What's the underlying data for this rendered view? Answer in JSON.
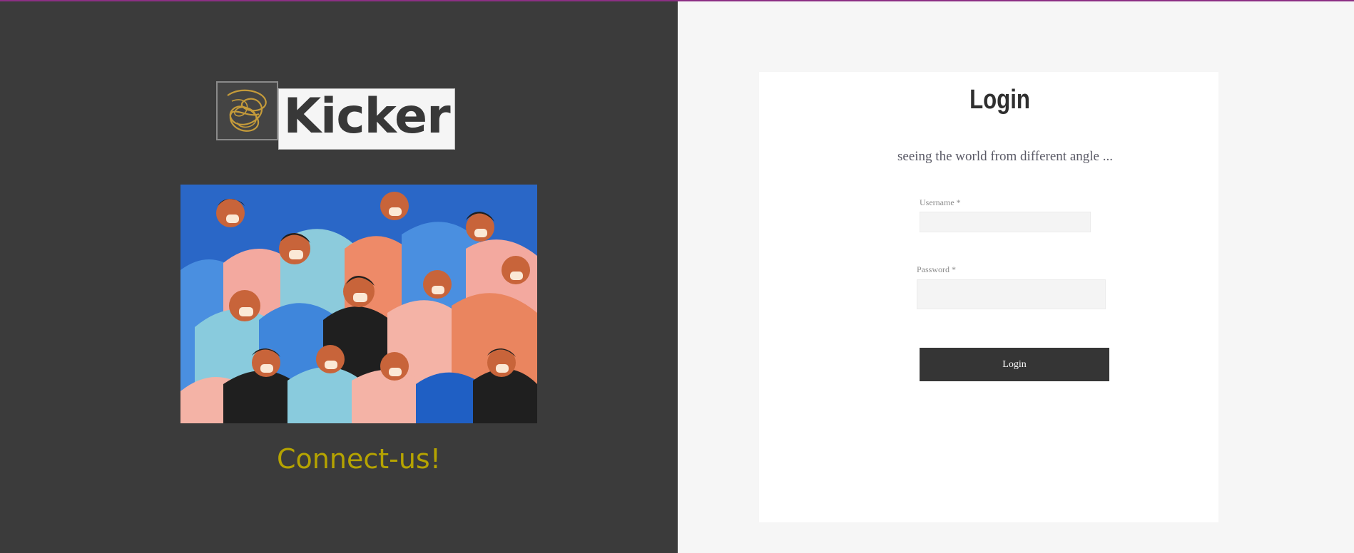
{
  "brand": {
    "logo_text": "Kicker",
    "tagline": "Connect-us!",
    "tagline_color": "#b5a300"
  },
  "illustration": {
    "subject": "crowd of people wearing face masks"
  },
  "login": {
    "title": "Login",
    "subtitle": "seeing the world from different angle ...",
    "username_label": "Username *",
    "username_value": "",
    "password_label": "Password *",
    "password_value": "",
    "button_label": "Login"
  },
  "colors": {
    "accent_line": "#8c2f84",
    "left_bg": "#3b3b3b",
    "right_bg": "#f6f6f6",
    "button_bg": "#353535"
  }
}
